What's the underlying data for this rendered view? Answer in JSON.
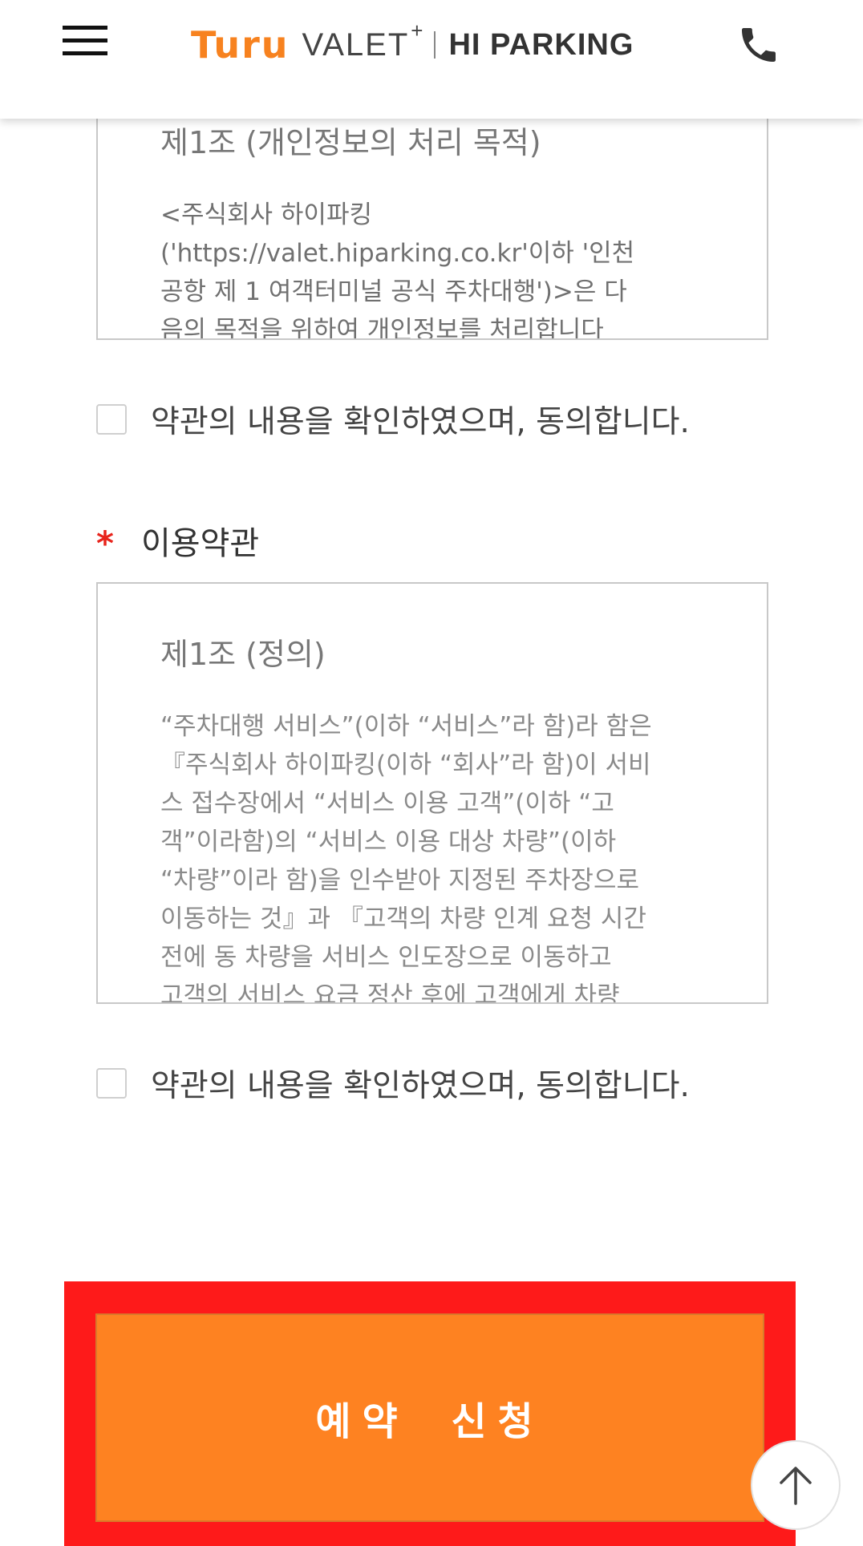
{
  "header": {
    "logo_turu": "Turu",
    "logo_valet": "VALET",
    "logo_plus": "+",
    "logo_hiparking": "HI PARKING"
  },
  "privacy_terms": {
    "title": "제1조 (개인정보의 처리 목적)",
    "body": "<주식회사 하이파킹\n('https://valet.hiparking.co.kr'이하 '인천\n공항 제 1 여객터미널 공식 주차대행')>은 다\n음의 목적을 위하여 개인정보를 처리합니다"
  },
  "agree_privacy": {
    "label": "약관의 내용을 확인하였으며, 동의합니다."
  },
  "usage_terms": {
    "required_mark": "*",
    "heading": "이용약관",
    "title": "제1조 (정의)",
    "body": "“주차대행 서비스”(이하 “서비스”라 함)라 함은\n『주식회사 하이파킹(이하 “회사”라 함)이 서비\n스 접수장에서 “서비스 이용 고객”(이하 “고\n객”이라함)의 “서비스 이용 대상 차량”(이하\n“차량”이라 함)을 인수받아 지정된 주차장으로\n이동하는 것』과 『고객의 차량 인계 요청 시간\n전에 동 차량을 서비스 인도장으로 이동하고\n고객의 서비스 요금 정산 후에 고객에게 차량"
  },
  "agree_usage": {
    "label": "약관의 내용을 확인하였으며, 동의합니다."
  },
  "submit": {
    "label": "예약 신청"
  },
  "colors": {
    "brand_orange": "#fe8221",
    "highlight_red": "#fe1a1a",
    "required_red": "#e8241c"
  },
  "icons": {
    "menu": "hamburger-menu-icon",
    "phone": "phone-icon",
    "top": "arrow-up-icon"
  }
}
